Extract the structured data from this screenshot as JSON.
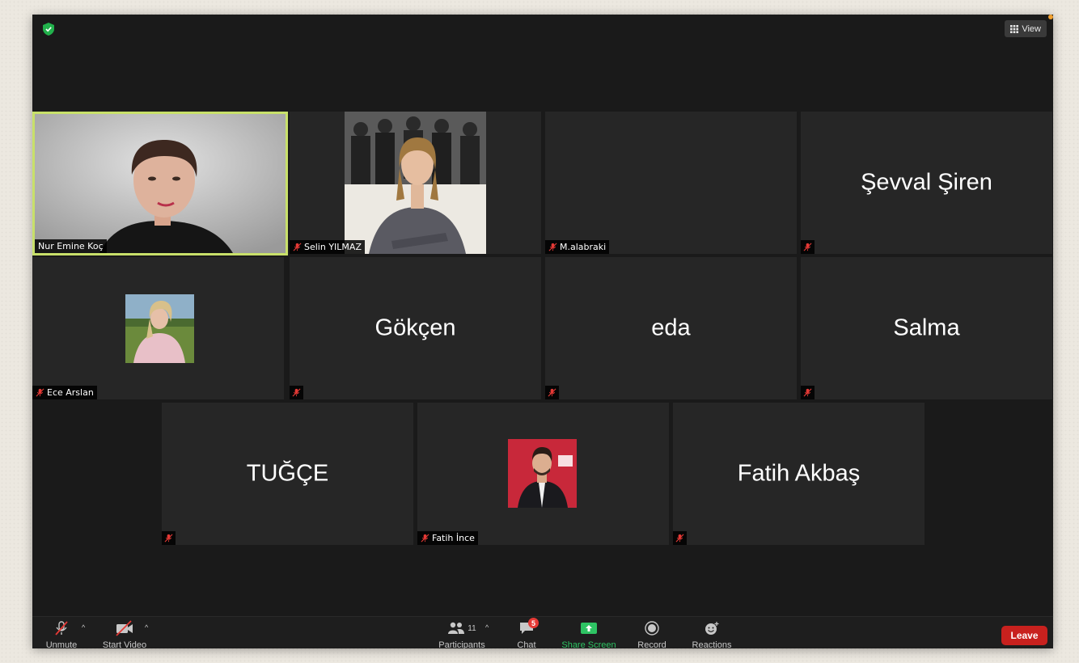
{
  "header": {
    "view_label": "View"
  },
  "tiles": {
    "nur": {
      "name": "Nur Emine Koç"
    },
    "selin": {
      "name": "Selin YILMAZ"
    },
    "alabraki": {
      "name": "M.alabraki"
    },
    "sevval": {
      "display": "Şevval Şiren"
    },
    "ece": {
      "name": "Ece Arslan"
    },
    "gokcen": {
      "display": "Gökçen"
    },
    "eda": {
      "display": "eda"
    },
    "salma": {
      "display": "Salma"
    },
    "tugce": {
      "display": "TUĞÇE"
    },
    "fatih_ince": {
      "name": "Fatih İnce"
    },
    "fatih_akbas": {
      "display": "Fatih Akbaş"
    }
  },
  "toolbar": {
    "unmute": "Unmute",
    "start_video": "Start Video",
    "participants": "Participants",
    "participants_count": "11",
    "chat": "Chat",
    "chat_badge": "5",
    "share_screen": "Share Screen",
    "record": "Record",
    "reactions": "Reactions",
    "leave": "Leave"
  },
  "colors": {
    "speaker_border": "#c8e06a",
    "share_green": "#2ec363",
    "leave_red": "#c8211e",
    "muted_red": "#e53935"
  }
}
